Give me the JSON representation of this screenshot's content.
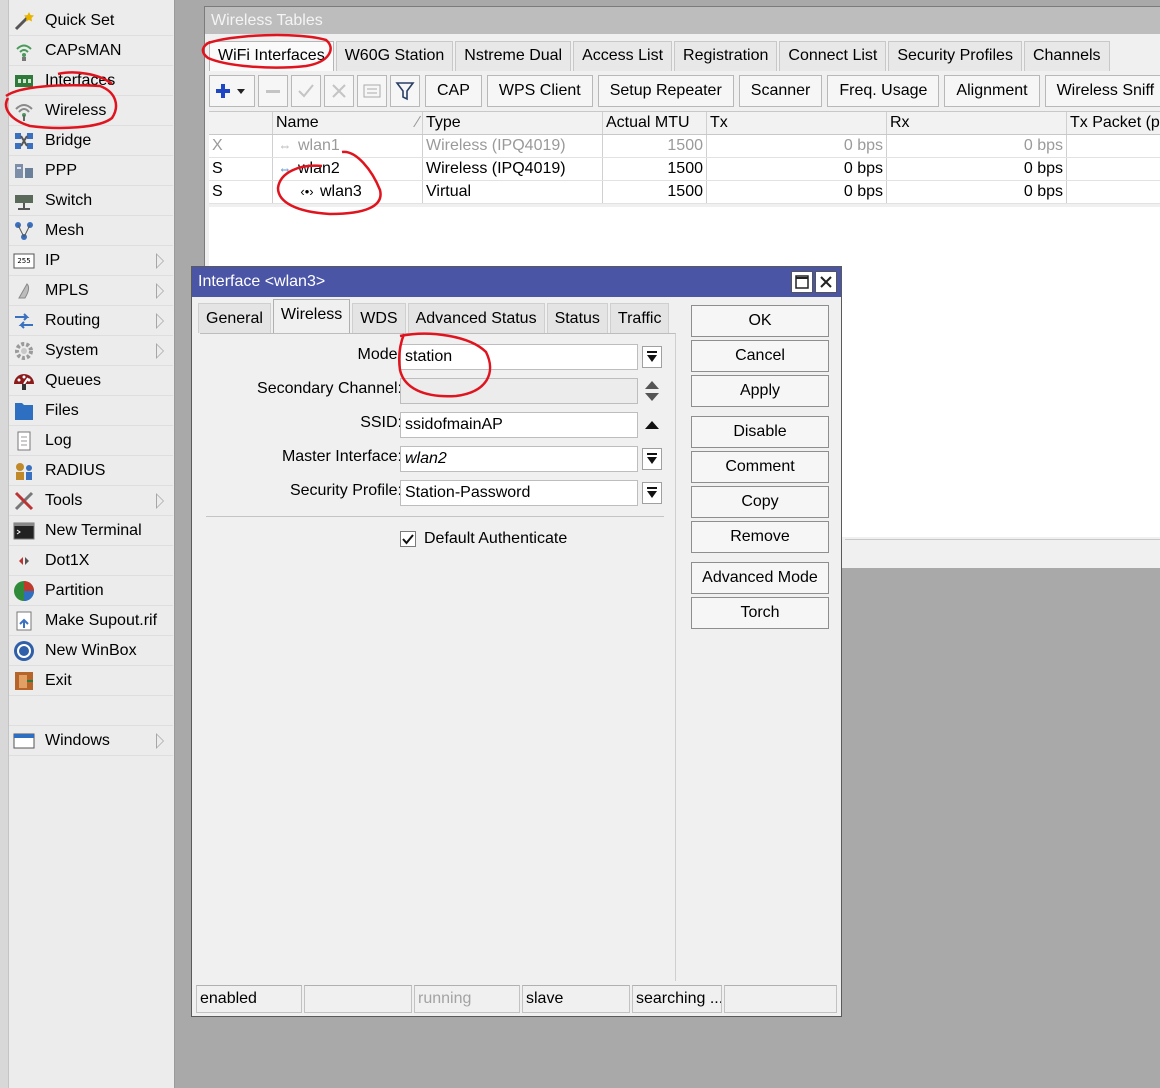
{
  "sidebar": {
    "items": [
      {
        "label": "Quick Set",
        "icon": "wand-icon",
        "submenu": false
      },
      {
        "label": "CAPsMAN",
        "icon": "capsman-icon",
        "submenu": false
      },
      {
        "label": "Interfaces",
        "icon": "interfaces-icon",
        "submenu": false
      },
      {
        "label": "Wireless",
        "icon": "wireless-icon",
        "submenu": false
      },
      {
        "label": "Bridge",
        "icon": "bridge-icon",
        "submenu": false
      },
      {
        "label": "PPP",
        "icon": "ppp-icon",
        "submenu": false
      },
      {
        "label": "Switch",
        "icon": "switch-icon",
        "submenu": false
      },
      {
        "label": "Mesh",
        "icon": "mesh-icon",
        "submenu": false
      },
      {
        "label": "IP",
        "icon": "ip-icon",
        "submenu": true,
        "badge": "255"
      },
      {
        "label": "MPLS",
        "icon": "mpls-icon",
        "submenu": true
      },
      {
        "label": "Routing",
        "icon": "routing-icon",
        "submenu": true
      },
      {
        "label": "System",
        "icon": "gear-icon",
        "submenu": true
      },
      {
        "label": "Queues",
        "icon": "queues-icon",
        "submenu": false
      },
      {
        "label": "Files",
        "icon": "folder-icon",
        "submenu": false
      },
      {
        "label": "Log",
        "icon": "log-icon",
        "submenu": false
      },
      {
        "label": "RADIUS",
        "icon": "radius-icon",
        "submenu": false
      },
      {
        "label": "Tools",
        "icon": "tools-icon",
        "submenu": true
      },
      {
        "label": "New Terminal",
        "icon": "terminal-icon",
        "submenu": false
      },
      {
        "label": "Dot1X",
        "icon": "dot1x-icon",
        "submenu": false
      },
      {
        "label": "Partition",
        "icon": "partition-icon",
        "submenu": false
      },
      {
        "label": "Make Supout.rif",
        "icon": "supout-icon",
        "submenu": false
      },
      {
        "label": "New WinBox",
        "icon": "winbox-icon",
        "submenu": false
      },
      {
        "label": "Exit",
        "icon": "exit-icon",
        "submenu": false
      }
    ],
    "windows": {
      "label": "Windows",
      "icon": "windows-icon",
      "submenu": true
    }
  },
  "wireless_tables": {
    "title": "Wireless Tables",
    "tabs": [
      "WiFi Interfaces",
      "W60G Station",
      "Nstreme Dual",
      "Access List",
      "Registration",
      "Connect List",
      "Security Profiles",
      "Channels"
    ],
    "active_tab": "WiFi Interfaces",
    "toolbar": {
      "buttons": [
        "CAP",
        "WPS Client",
        "Setup Repeater",
        "Scanner",
        "Freq. Usage",
        "Alignment",
        "Wireless Sniff"
      ]
    },
    "table": {
      "columns": [
        "",
        "Name",
        "Type",
        "Actual MTU",
        "Tx",
        "Rx",
        "Tx Packet (p"
      ],
      "rows": [
        {
          "flag": "X",
          "name": "wlan1",
          "type": "Wireless (IPQ4019)",
          "mtu": "1500",
          "tx": "0 bps",
          "rx": "0 bps",
          "disabled": true
        },
        {
          "flag": "S",
          "name": "wlan2",
          "type": "Wireless (IPQ4019)",
          "mtu": "1500",
          "tx": "0 bps",
          "rx": "0 bps",
          "disabled": false
        },
        {
          "flag": "S",
          "name": "wlan3",
          "type": "Virtual",
          "mtu": "1500",
          "tx": "0 bps",
          "rx": "0 bps",
          "disabled": false
        }
      ]
    }
  },
  "dialog": {
    "title": "Interface <wlan3>",
    "tabs": [
      "General",
      "Wireless",
      "WDS",
      "Advanced Status",
      "Status",
      "Traffic"
    ],
    "active_tab": "Wireless",
    "fields": {
      "mode": {
        "label": "Mode:",
        "value": "station"
      },
      "secondary_channel": {
        "label": "Secondary Channel:",
        "value": ""
      },
      "ssid": {
        "label": "SSID:",
        "value": "ssidofmainAP"
      },
      "master_interface": {
        "label": "Master Interface:",
        "value": "wlan2"
      },
      "security_profile": {
        "label": "Security Profile:",
        "value": "Station-Password"
      }
    },
    "default_authenticate": {
      "label": "Default Authenticate",
      "checked": true
    },
    "buttons": {
      "ok": "OK",
      "cancel": "Cancel",
      "apply": "Apply",
      "disable": "Disable",
      "comment": "Comment",
      "copy": "Copy",
      "remove": "Remove",
      "advanced_mode": "Advanced Mode",
      "torch": "Torch"
    },
    "status": {
      "state": "enabled",
      "blank": "",
      "running": "running",
      "slave": "slave",
      "searching": "searching ..."
    }
  },
  "colors": {
    "annotation": "#e0141e",
    "dialog_title": "#4b55a6",
    "plus_icon": "#1f47c4"
  }
}
